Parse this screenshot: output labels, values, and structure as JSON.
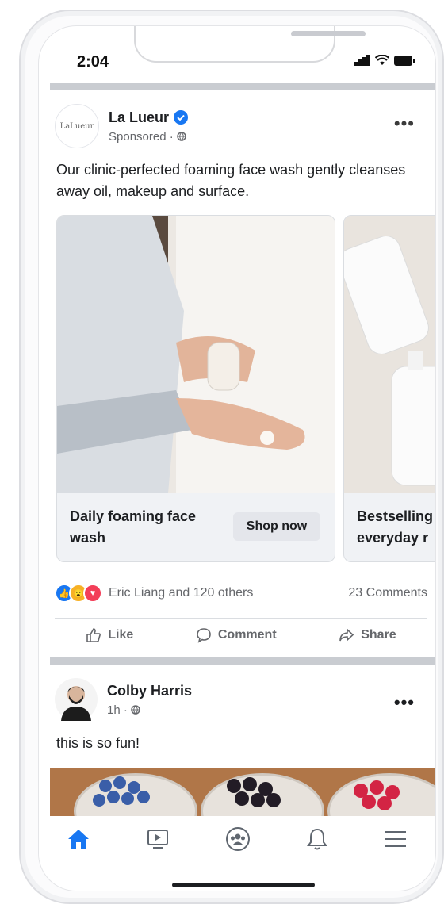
{
  "status_bar": {
    "time": "2:04"
  },
  "ad_post": {
    "brand_logo_text": "LaLueur",
    "page_name": "La Lueur",
    "sponsored_label": "Sponsored · ",
    "caption": "Our clinic-perfected foaming face wash gently cleanses away oil, makeup and surface.",
    "carousel": [
      {
        "title": "Daily foaming face wash",
        "cta": "Shop now"
      },
      {
        "title": "Bestselling everyday r"
      }
    ],
    "reactions_text": "Eric Liang and 120 others",
    "comments_count": "23 Comments",
    "actions": {
      "like": "Like",
      "comment": "Comment",
      "share": "Share"
    }
  },
  "user_post": {
    "author": "Colby Harris",
    "time": "1h · ",
    "text": "this is so fun!"
  },
  "colors": {
    "accent": "#1877f2",
    "like_blue": "#1877f2",
    "love_red": "#f33e58",
    "wow_yellow": "#f7b125"
  },
  "nav": [
    "home-icon",
    "watch-icon",
    "groups-icon",
    "notifications-icon",
    "menu-icon"
  ]
}
